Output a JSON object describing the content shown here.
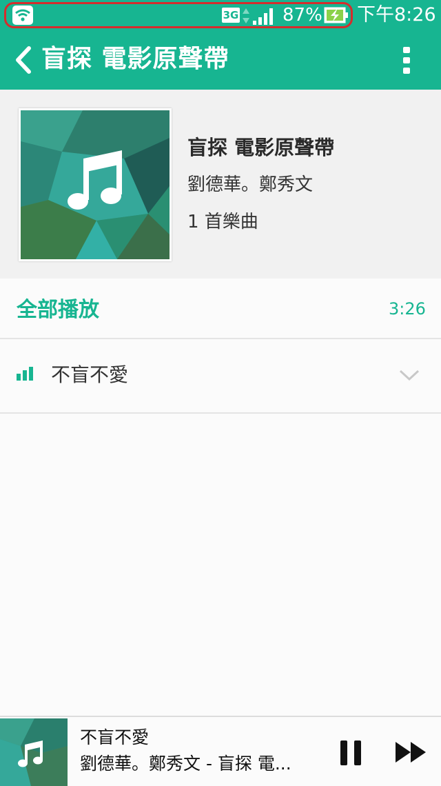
{
  "status_bar": {
    "network_type": "3G",
    "battery_percent": "87%",
    "time": "下午8:26",
    "accent": "#17b591",
    "highlight_color": "#d62c2c",
    "icons": [
      "wifi-icon",
      "network-arrows-icon",
      "signal-icon",
      "battery-charging-icon"
    ]
  },
  "toolbar": {
    "title": "盲探 電影原聲帶",
    "icons": [
      "back-icon",
      "overflow-menu-icon"
    ]
  },
  "album": {
    "title": "盲探 電影原聲帶",
    "artist": "劉德華。鄭秀文",
    "track_count": "1 首樂曲",
    "cover_icon": "music-note-icon"
  },
  "play_all": {
    "label": "全部播放",
    "duration": "3:26"
  },
  "tracks": [
    {
      "title": "不盲不愛",
      "state_icon": "now-playing-equalizer-icon",
      "expand_icon": "chevron-down-icon"
    }
  ],
  "mini_player": {
    "title": "不盲不愛",
    "subtitle": "劉德華。鄭秀文 - 盲探 電...",
    "icons": [
      "music-note-icon",
      "pause-icon",
      "fast-forward-icon"
    ]
  },
  "colors": {
    "accent": "#17b591",
    "background": "#fbfbfb",
    "header_background": "#f1f1f1"
  }
}
